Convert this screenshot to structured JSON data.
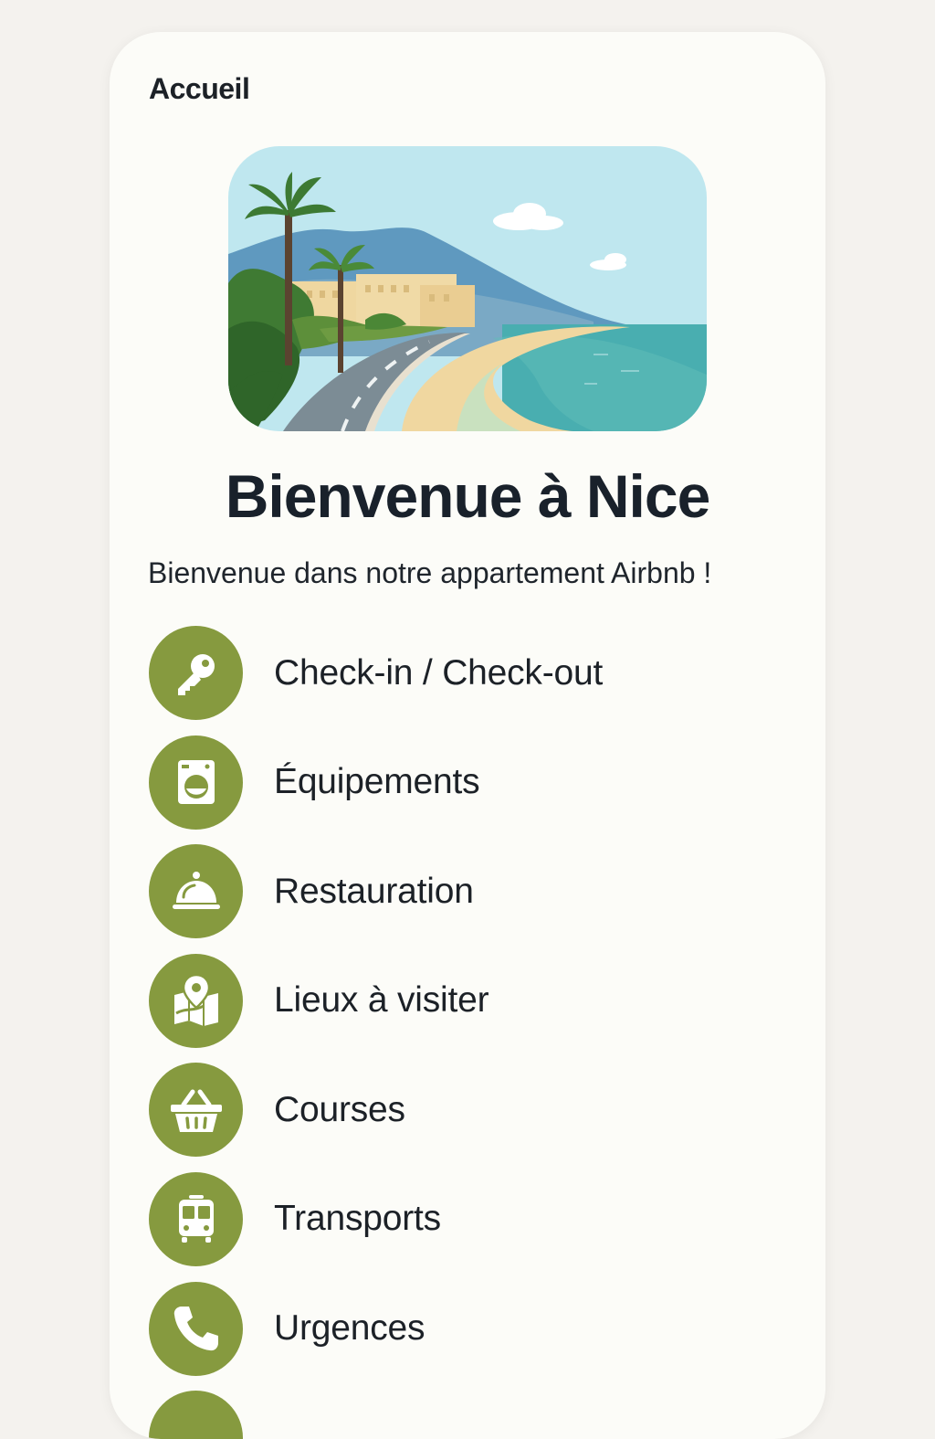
{
  "header": {
    "title": "Accueil"
  },
  "hero": {
    "image": "nice-promenade-illustration"
  },
  "welcome": {
    "heading": "Bienvenue à Nice",
    "text": "Bienvenue dans notre appartement Airbnb !"
  },
  "menu": {
    "items": [
      {
        "label": "Check-in / Check-out",
        "icon": "key-icon"
      },
      {
        "label": "Équipements",
        "icon": "washing-machine-icon"
      },
      {
        "label": "Restauration",
        "icon": "cloche-icon"
      },
      {
        "label": "Lieux à visiter",
        "icon": "map-pin-icon"
      },
      {
        "label": "Courses",
        "icon": "basket-icon"
      },
      {
        "label": "Transports",
        "icon": "tram-icon"
      },
      {
        "label": "Urgences",
        "icon": "phone-icon"
      }
    ]
  },
  "colors": {
    "accent": "#869a3f",
    "background": "#fcfcf8",
    "text": "#1c2127"
  }
}
